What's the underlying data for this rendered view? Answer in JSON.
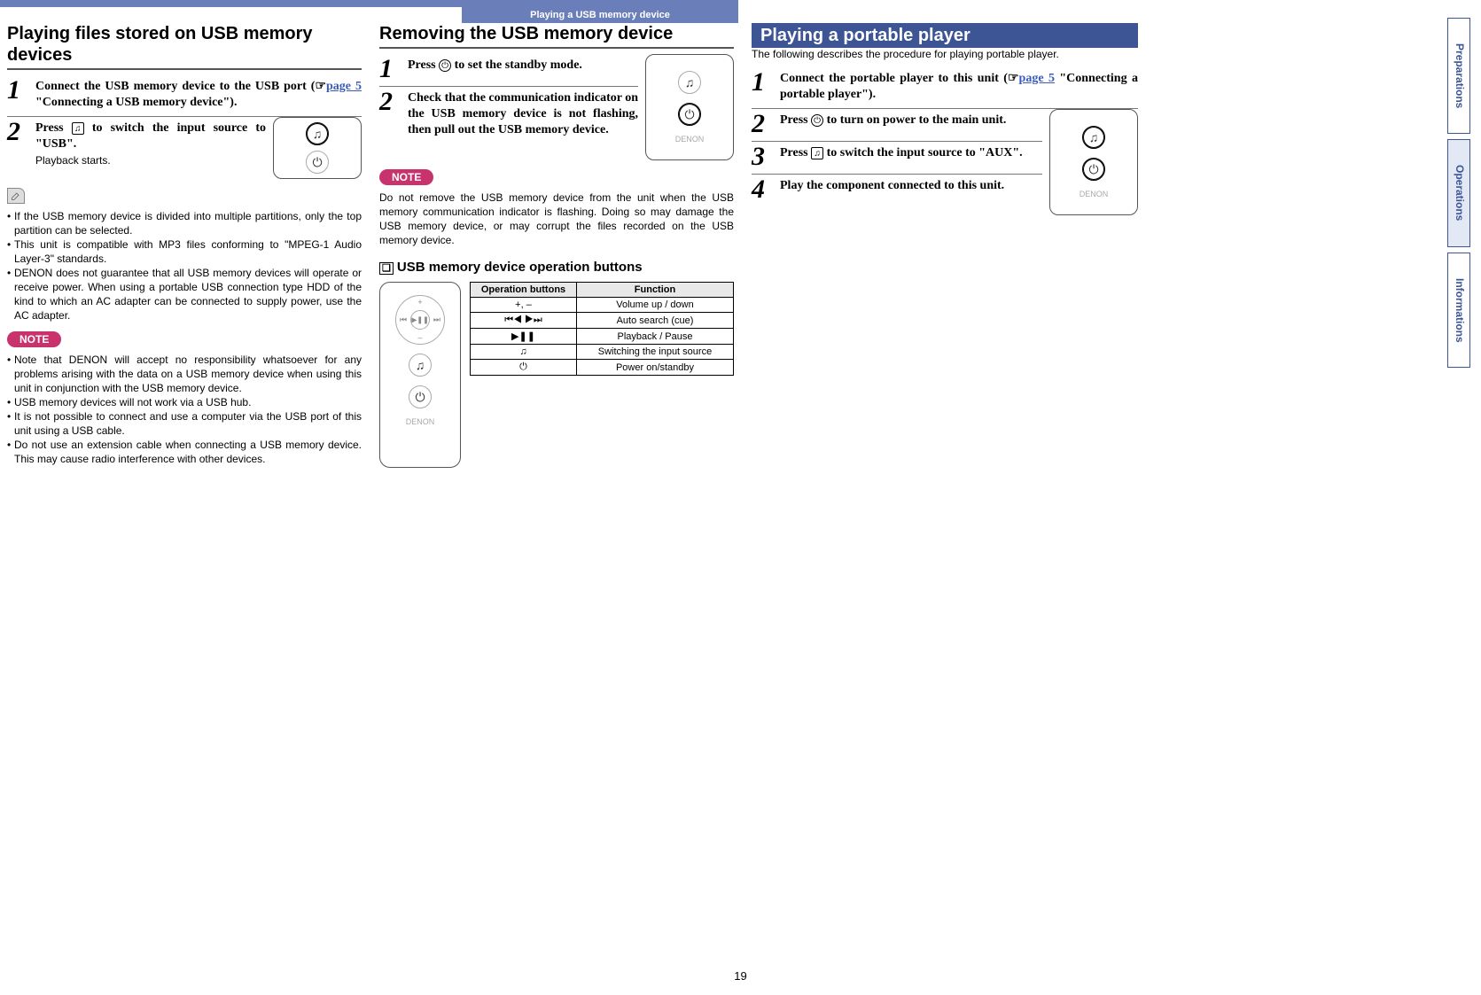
{
  "crumb": "Playing a USB memory device",
  "page_number": "19",
  "side_tabs": [
    "Preparations",
    "Operations",
    "Informations"
  ],
  "col1": {
    "heading": "Playing files stored on USB memory devices",
    "steps": [
      {
        "num": "1",
        "body_a": "Connect the USB memory device to the USB port (",
        "link": "page 5",
        "body_b": " \"Connecting a USB memory device\")."
      },
      {
        "num": "2",
        "body_a": "Press ",
        "icon": "♫",
        "body_b": " to switch the input source to \"USB\".",
        "sub": "Playback starts."
      }
    ],
    "tips": [
      "If the USB memory device is divided into multiple partitions, only the top partition can be selected.",
      "This unit is compatible with MP3 files conforming to \"MPEG-1 Audio Layer-3\" standards.",
      "DENON does not guarantee that all USB memory devices will operate or receive power. When using a portable USB connection type HDD of the kind to which an AC adapter can be connected to supply power, use the AC adapter."
    ],
    "note_label": "NOTE",
    "notes": [
      "Note that DENON will accept no responsibility whatsoever for any problems arising with the data on a USB memory device when using this unit in conjunction with the USB memory device.",
      "USB memory devices will not work via a USB hub.",
      "It is not possible to connect and use a computer via the USB port of this unit using a USB cable.",
      "Do not use an extension cable when connecting a USB memory device. This may cause radio interference with other devices."
    ]
  },
  "col2": {
    "heading": "Removing the USB memory device",
    "steps": [
      {
        "num": "1",
        "body_a": "Press ",
        "icon": "⏻",
        "body_b": " to set the standby mode."
      },
      {
        "num": "2",
        "body": "Check that the communication indicator on the USB memory device is not flashing, then pull out the USB memory device."
      }
    ],
    "note_label": "NOTE",
    "note_para": "Do not remove the USB memory device from the unit when the USB memory communication indicator is flashing. Doing so may damage the USB memory device, or may corrupt the files recorded on the USB memory device.",
    "subheading": "USB memory device operation buttons",
    "table": {
      "headers": [
        "Operation buttons",
        "Function"
      ],
      "rows": [
        [
          "+, –",
          "Volume up / down"
        ],
        [
          "⏮◀ ▶⏭",
          "Auto search (cue)"
        ],
        [
          "▶❚❚",
          "Playback / Pause"
        ],
        [
          "♫",
          "Switching the input source"
        ],
        [
          "⏻",
          "Power on/standby"
        ]
      ]
    },
    "brand": "DENON"
  },
  "col3": {
    "section_title": "Playing a portable player",
    "intro": "The following describes the procedure for playing portable player.",
    "steps": [
      {
        "num": "1",
        "body_a": "Connect the portable player to this unit (",
        "link": "page 5",
        "body_b": " \"Connecting a portable player\")."
      },
      {
        "num": "2",
        "body_a": "Press ",
        "icon": "⏻",
        "body_b": " to turn on power to the main unit."
      },
      {
        "num": "3",
        "body_a": "Press ",
        "icon": "♫",
        "body_b": " to switch the input source to \"AUX\"."
      },
      {
        "num": "4",
        "body": "Play the component connected to this unit."
      }
    ],
    "brand": "DENON"
  }
}
